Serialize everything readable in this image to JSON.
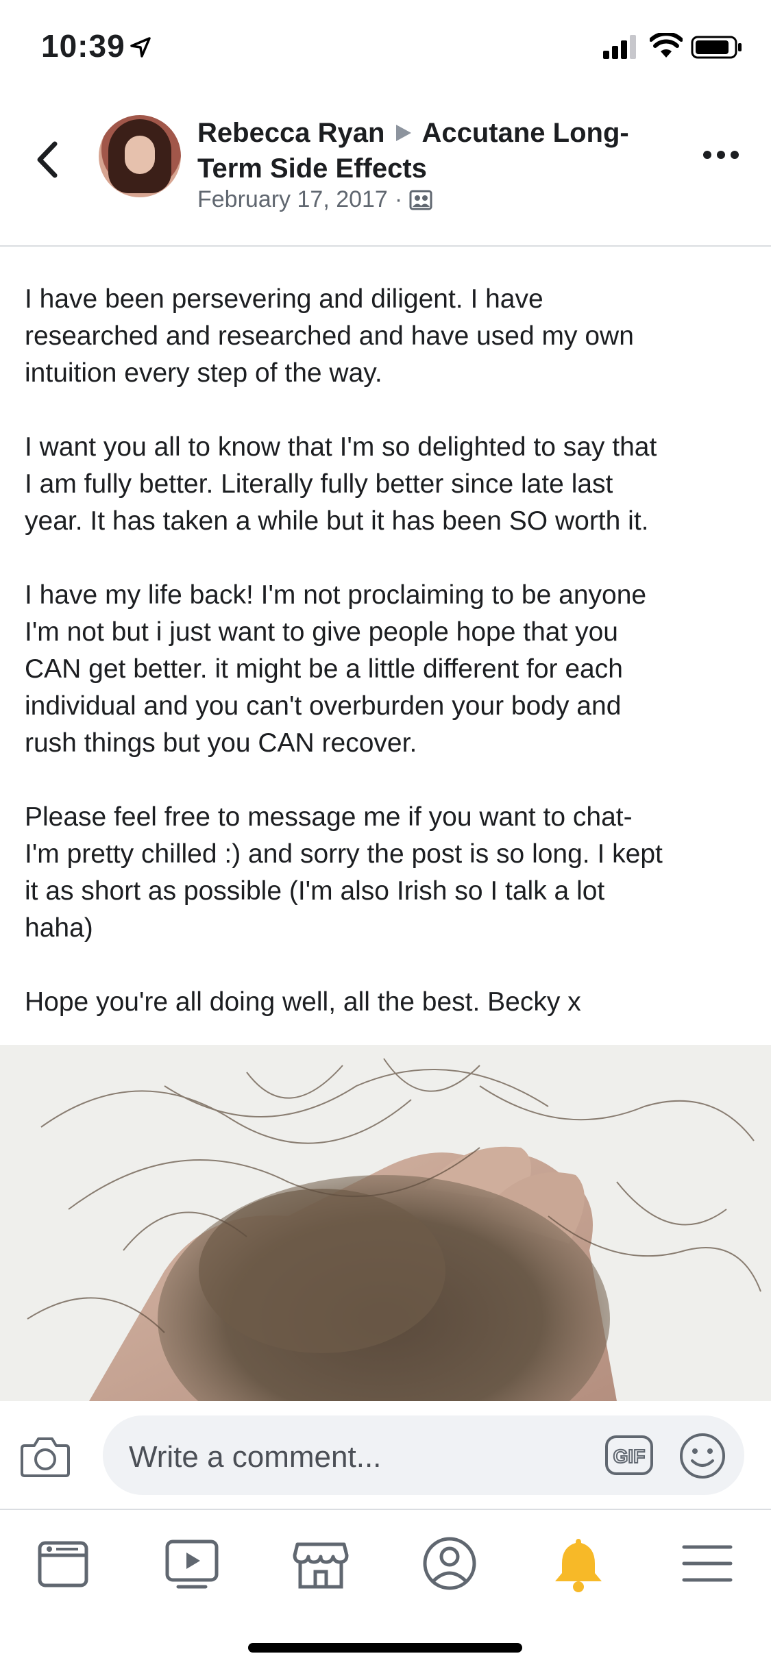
{
  "status_bar": {
    "time": "10:39"
  },
  "header": {
    "author": "Rebecca Ryan",
    "group_line1": "Accutane Long-",
    "group_line2": "Term Side Effects",
    "date": "February 17, 2017",
    "meta_separator": "·"
  },
  "post": {
    "paragraphs": [
      "I have been persevering and diligent. I have\nresearched and researched and have used my own\nintuition every step of the way.",
      "I want you all to know that I'm so delighted to say that\nI am fully better. Literally fully better since late last\nyear. It has taken a while but it has been SO worth it.",
      "I have my life back! I'm not proclaiming to be anyone\nI'm not but i just want to give people hope that you\nCAN get better. it might be a little different for each\nindividual and you can't overburden your body and\nrush things but you CAN recover.",
      "Please feel free to message me if you want to chat-\nI'm pretty chilled :) and sorry the post is so long. I kept\nit as short as possible (I'm also Irish so I talk a lot\nhaha)",
      "Hope you're all doing well, all the best. Becky x"
    ]
  },
  "comment_bar": {
    "placeholder": "Write a comment...",
    "gif_label": "GIF"
  },
  "tab_bar": {
    "tabs": [
      "news-feed",
      "watch",
      "marketplace",
      "profile",
      "notifications",
      "menu"
    ],
    "active_color": "#f7b928",
    "inactive_color": "#606770"
  }
}
